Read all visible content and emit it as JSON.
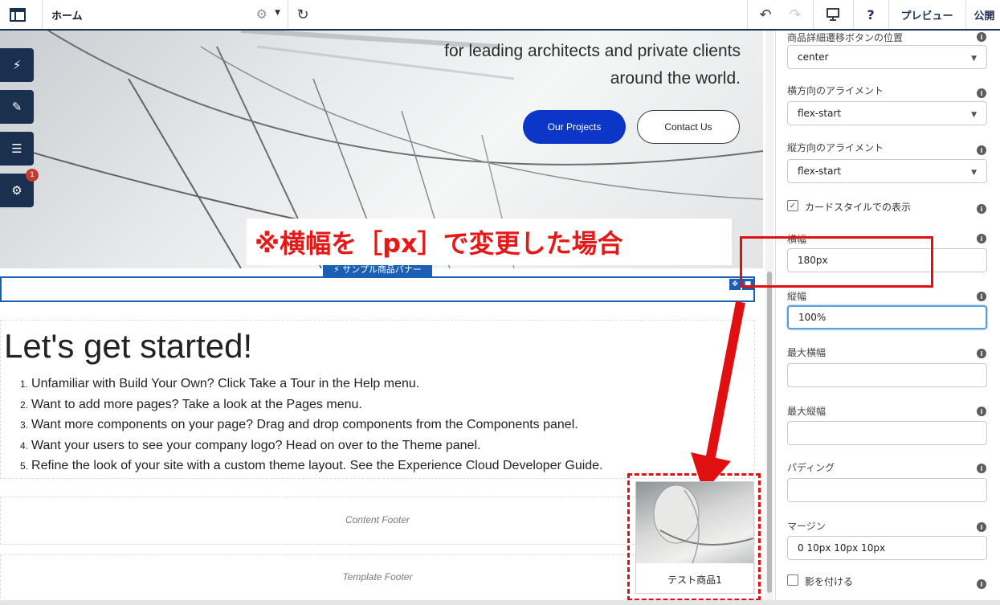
{
  "topbar": {
    "page_name": "ホーム",
    "preview_label": "プレビュー",
    "publish_label": "公開"
  },
  "hero": {
    "line1": "for leading architects and private clients",
    "line2": "around the world.",
    "primary_button": "Our Projects",
    "secondary_button": "Contact Us"
  },
  "side_tools": {
    "settings_badge": "1"
  },
  "component": {
    "tab_label": "⚡ サンプル商品バナー"
  },
  "started": {
    "title": "Let's get started!",
    "steps": [
      {
        "num": "1.",
        "text": "Unfamiliar with Build Your Own? Click Take a Tour in the Help menu."
      },
      {
        "num": "2.",
        "text": "Want to add more pages? Take a look at the Pages menu."
      },
      {
        "num": "3.",
        "text": "Want more components on your page? Drag and drop components from the Components panel."
      },
      {
        "num": "4.",
        "text": "Want your users to see your company logo? Head on over to the Theme panel."
      },
      {
        "num": "5.",
        "text": "Refine the look of your site with a custom theme layout. See the Experience Cloud Developer Guide."
      }
    ]
  },
  "footers": {
    "content": "Content Footer",
    "template": "Template Footer"
  },
  "card": {
    "name": "テスト商品1"
  },
  "panel": {
    "position_label": "商品詳細遷移ボタンの位置",
    "position_value": "center",
    "h_align_label": "横方向のアライメント",
    "h_align_value": "flex-start",
    "v_align_label": "縦方向のアライメント",
    "v_align_value": "flex-start",
    "card_style_label": "カードスタイルでの表示",
    "width_label": "横幅",
    "width_value": "180px",
    "height_label": "縦幅",
    "height_value": "100%",
    "max_width_label": "最大横幅",
    "max_height_label": "最大縦幅",
    "padding_label": "パディング",
    "margin_label": "マージン",
    "margin_value": "0 10px 10px 10px",
    "shadow_label": "影を付ける"
  },
  "annotation": {
    "caption": "※横幅を［px］で変更した場合"
  },
  "colors": {
    "accent": "#0b36c8",
    "navy": "#1b2f4f",
    "annotation": "#e01010",
    "select_blue": "#1b5fb5"
  }
}
